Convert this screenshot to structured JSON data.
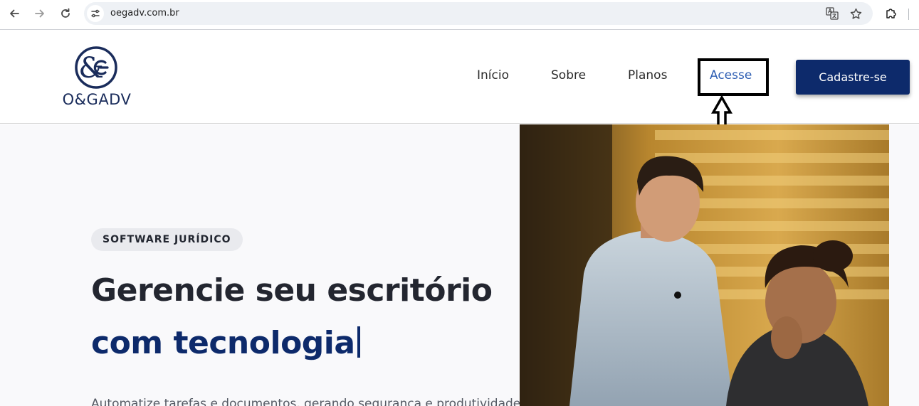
{
  "browser": {
    "url": "oegadv.com.br",
    "icons": {
      "back": "arrow-left-icon",
      "forward": "arrow-right-icon",
      "reload": "reload-icon",
      "site_info": "tune-icon",
      "translate": "translate-icon",
      "bookmark": "star-icon",
      "extensions": "puzzle-icon"
    }
  },
  "header": {
    "logo_text": "O&GADV",
    "logo_symbol": "&",
    "nav": {
      "inicio": "Início",
      "sobre": "Sobre",
      "planos": "Planos",
      "acesse": "Acesse"
    },
    "cta_label": "Cadastre-se"
  },
  "hero": {
    "tag": "SOFTWARE JURÍDICO",
    "headline_line1": "Gerencie seu escritório",
    "headline_line2": "com tecnologia",
    "subtext": "Automatize tarefas e documentos, gerando segurança e produtividade"
  },
  "colors": {
    "brand_navy": "#0d2a6b",
    "active_link": "#2f5fb3",
    "headline": "#232630"
  }
}
